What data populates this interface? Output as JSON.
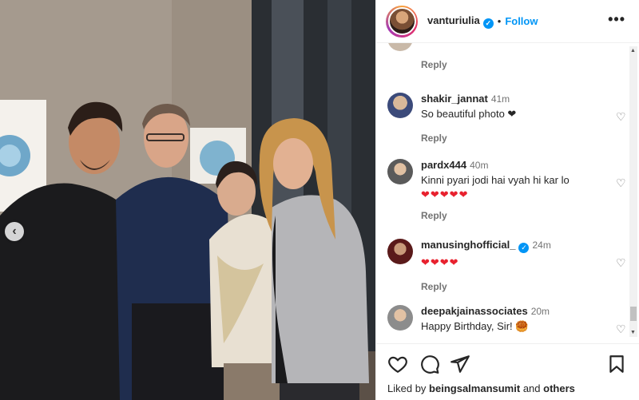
{
  "header": {
    "username": "vanturiulia",
    "separator": "•",
    "follow_label": "Follow",
    "more_label": "•••"
  },
  "photo": {
    "prev_label": "‹"
  },
  "comments": [
    {
      "user": "",
      "time": "",
      "text": "❤❤",
      "reply": "Reply",
      "verified": false
    },
    {
      "user": "shakir_jannat",
      "time": "41m",
      "text": "So beautiful photo ❤",
      "reply": "Reply",
      "verified": false
    },
    {
      "user": "pardx444",
      "time": "40m",
      "text": "Kinni pyari jodi hai vyah hi kar lo",
      "hearts": "❤❤❤❤❤",
      "reply": "Reply",
      "verified": false
    },
    {
      "user": "manusinghofficial_",
      "time": "24m",
      "text": "",
      "hearts": "❤❤❤❤",
      "reply": "Reply",
      "verified": true
    },
    {
      "user": "deepakjainassociates",
      "time": "20m",
      "text": "Happy Birthday, Sir! 🥮",
      "reply": "",
      "verified": false
    }
  ],
  "footer": {
    "liked_prefix": "Liked by",
    "liked_user": "beingsalmansumit",
    "liked_mid": "and",
    "liked_others": "others"
  },
  "icons": {
    "heart": "heart-icon",
    "comment": "comment-icon",
    "share": "share-icon",
    "save": "bookmark-icon"
  },
  "colors": {
    "accent": "#0095f6",
    "heart_red": "#e8212e",
    "muted": "#737373"
  }
}
